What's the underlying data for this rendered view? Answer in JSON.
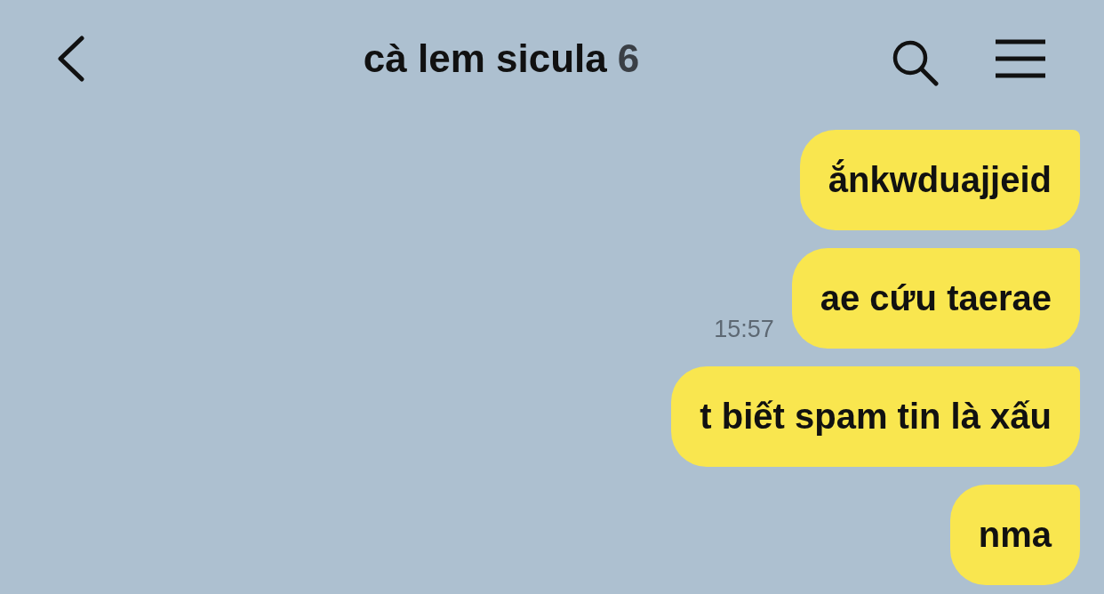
{
  "header": {
    "title": "cà lem sicula",
    "member_count": "6"
  },
  "messages": [
    {
      "text": "ắnkwduajjeid"
    },
    {
      "text": "ae cứu taerae",
      "time": "15:57"
    },
    {
      "text": "t biết spam tin là xấu"
    },
    {
      "text": "nma"
    }
  ]
}
